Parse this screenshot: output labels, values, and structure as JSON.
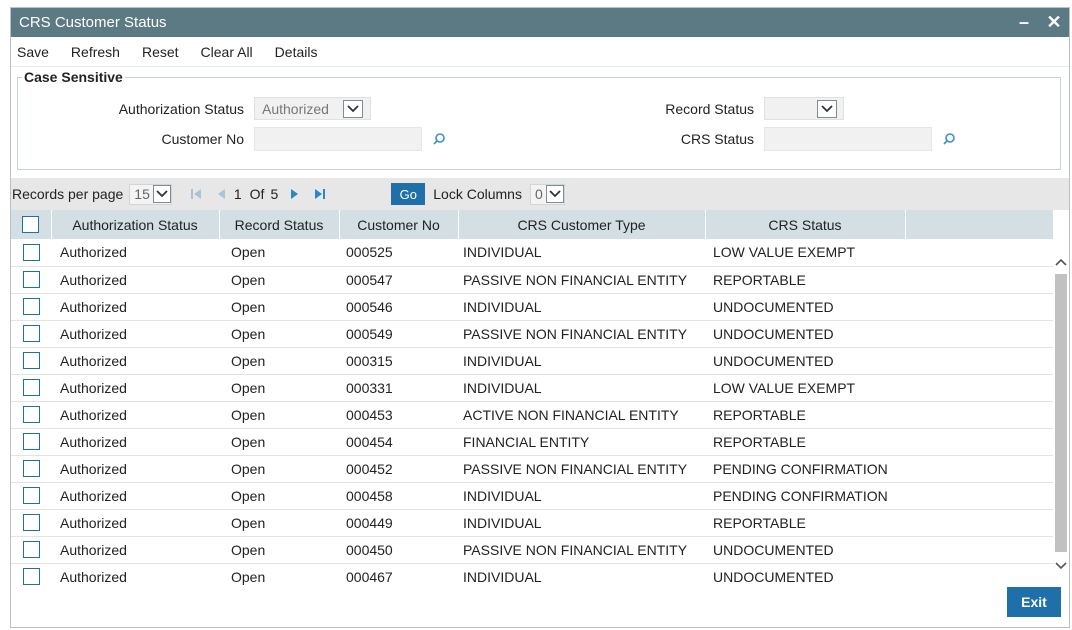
{
  "window": {
    "title": "CRS Customer Status",
    "minimize_icon": "minimize-icon",
    "close_icon": "close-icon"
  },
  "toolbar": {
    "save": "Save",
    "refresh": "Refresh",
    "reset": "Reset",
    "clear_all": "Clear All",
    "details": "Details"
  },
  "criteria": {
    "legend": "Case Sensitive",
    "auth_status_label": "Authorization Status",
    "auth_status_value": "Authorized",
    "record_status_label": "Record Status",
    "record_status_value": "",
    "customer_no_label": "Customer No",
    "customer_no_value": "",
    "crs_status_label": "CRS Status",
    "crs_status_value": ""
  },
  "pager": {
    "records_label": "Records per page",
    "records_value": "15",
    "current_page": "1",
    "of_label": "Of",
    "total_pages": "5",
    "go_label": "Go",
    "lock_label": "Lock Columns",
    "lock_value": "0"
  },
  "grid": {
    "columns": [
      "Authorization Status",
      "Record Status",
      "Customer No",
      "CRS Customer Type",
      "CRS Status"
    ],
    "rows": [
      [
        "Authorized",
        "Open",
        "000525",
        "INDIVIDUAL",
        "LOW VALUE EXEMPT"
      ],
      [
        "Authorized",
        "Open",
        "000547",
        "PASSIVE NON FINANCIAL ENTITY",
        "REPORTABLE"
      ],
      [
        "Authorized",
        "Open",
        "000546",
        "INDIVIDUAL",
        "UNDOCUMENTED"
      ],
      [
        "Authorized",
        "Open",
        "000549",
        "PASSIVE NON FINANCIAL ENTITY",
        "UNDOCUMENTED"
      ],
      [
        "Authorized",
        "Open",
        "000315",
        "INDIVIDUAL",
        "UNDOCUMENTED"
      ],
      [
        "Authorized",
        "Open",
        "000331",
        "INDIVIDUAL",
        "LOW VALUE EXEMPT"
      ],
      [
        "Authorized",
        "Open",
        "000453",
        "ACTIVE NON FINANCIAL ENTITY",
        "REPORTABLE"
      ],
      [
        "Authorized",
        "Open",
        "000454",
        "FINANCIAL ENTITY",
        "REPORTABLE"
      ],
      [
        "Authorized",
        "Open",
        "000452",
        "PASSIVE NON FINANCIAL ENTITY",
        "PENDING CONFIRMATION"
      ],
      [
        "Authorized",
        "Open",
        "000458",
        "INDIVIDUAL",
        "PENDING CONFIRMATION"
      ],
      [
        "Authorized",
        "Open",
        "000449",
        "INDIVIDUAL",
        "REPORTABLE"
      ],
      [
        "Authorized",
        "Open",
        "000450",
        "PASSIVE NON FINANCIAL ENTITY",
        "UNDOCUMENTED"
      ],
      [
        "Authorized",
        "Open",
        "000467",
        "INDIVIDUAL",
        "UNDOCUMENTED"
      ]
    ]
  },
  "footer": {
    "exit_label": "Exit"
  },
  "colors": {
    "titlebar": "#5b7a83",
    "accent": "#1f6fa8",
    "grid_header": "#d4dfe3"
  }
}
